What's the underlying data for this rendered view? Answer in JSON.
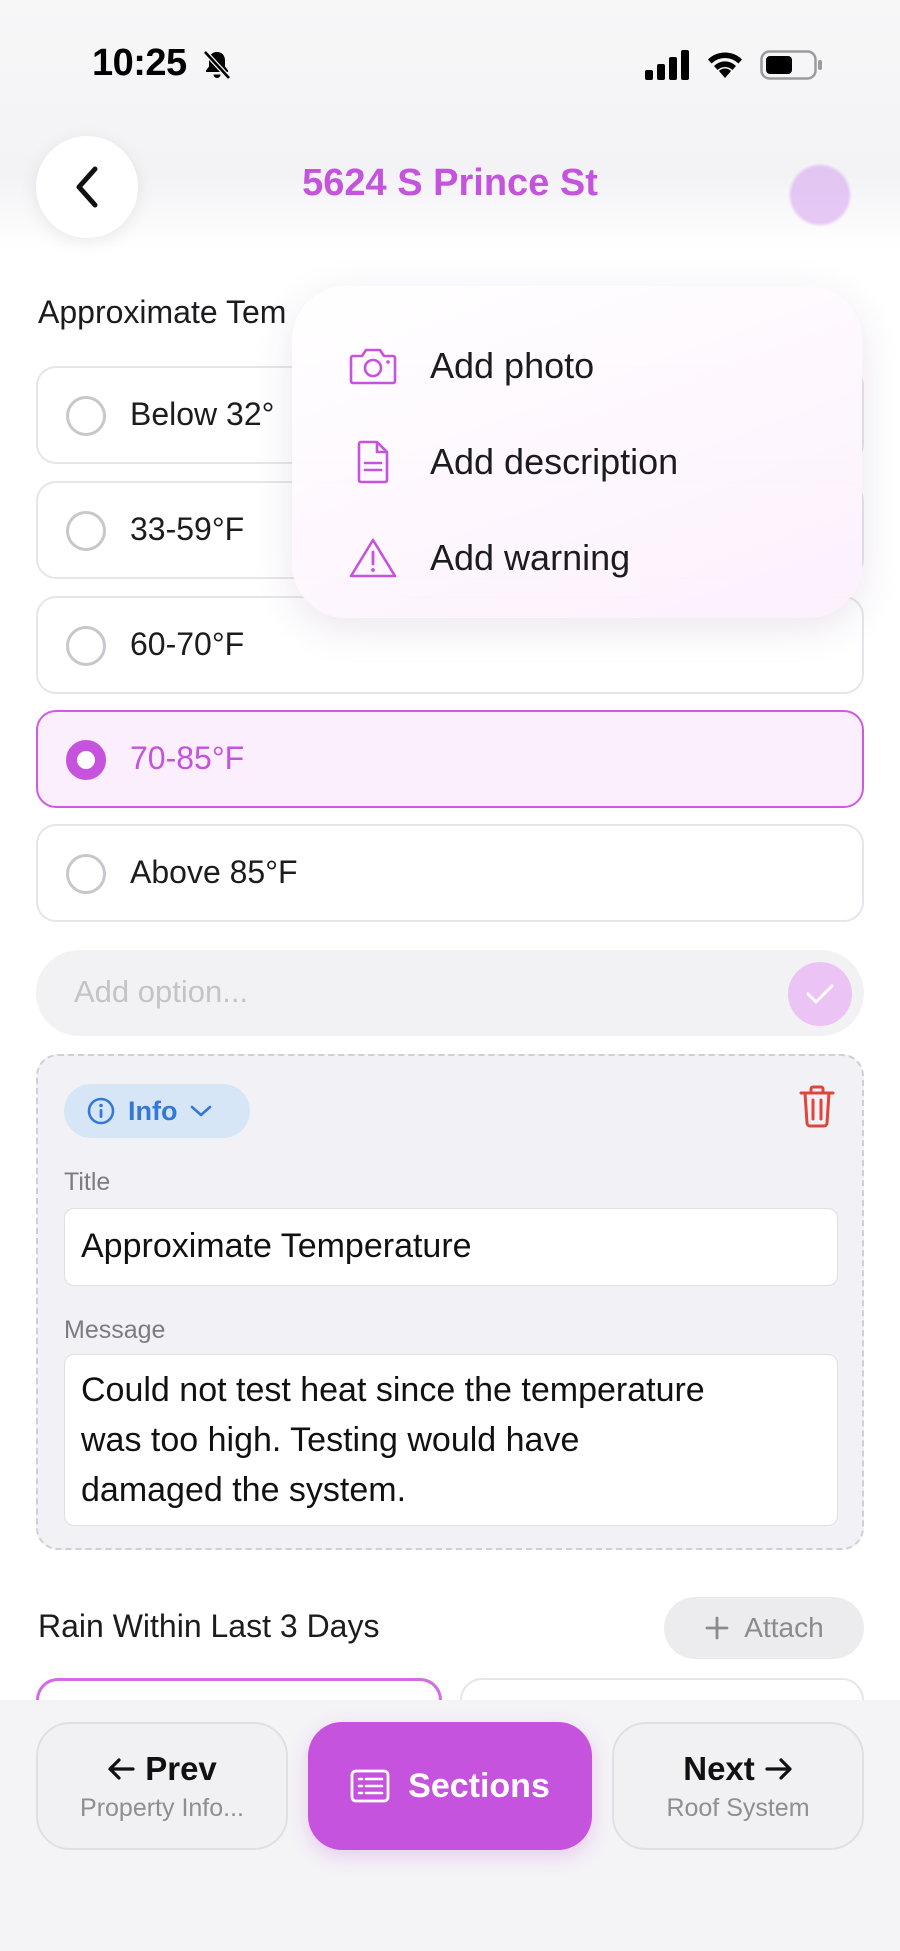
{
  "status_bar": {
    "time": "10:25"
  },
  "header": {
    "title": "5624 S Prince St"
  },
  "question": {
    "label": "Approximate Tem",
    "options": [
      {
        "label": "Below 32°",
        "selected": false
      },
      {
        "label": "33-59°F",
        "selected": false
      },
      {
        "label": "60-70°F",
        "selected": false
      },
      {
        "label": "70-85°F",
        "selected": true
      },
      {
        "label": "Above 85°F",
        "selected": false
      }
    ],
    "add_option_placeholder": "Add option..."
  },
  "popup_menu": {
    "items": [
      {
        "label": "Add photo",
        "icon": "camera-icon"
      },
      {
        "label": "Add description",
        "icon": "document-icon"
      },
      {
        "label": "Add warning",
        "icon": "warning-icon"
      }
    ]
  },
  "info_card": {
    "type_label": "Info",
    "title_label": "Title",
    "title_value": "Approximate Temperature",
    "message_label": "Message",
    "message_lines": [
      "Could not test heat since the temperature",
      "was too high. Testing would have",
      "damaged the system."
    ]
  },
  "next_question": {
    "label": "Rain Within Last 3 Days",
    "attach_label": "Attach"
  },
  "bottom_nav": {
    "prev_label": "Prev",
    "prev_sub": "Property Info...",
    "sections_label": "Sections",
    "next_label": "Next",
    "next_sub": "Roof System"
  },
  "colors": {
    "accent": "#c653dd",
    "info_blue": "#3478d8",
    "danger": "#e0453c"
  }
}
